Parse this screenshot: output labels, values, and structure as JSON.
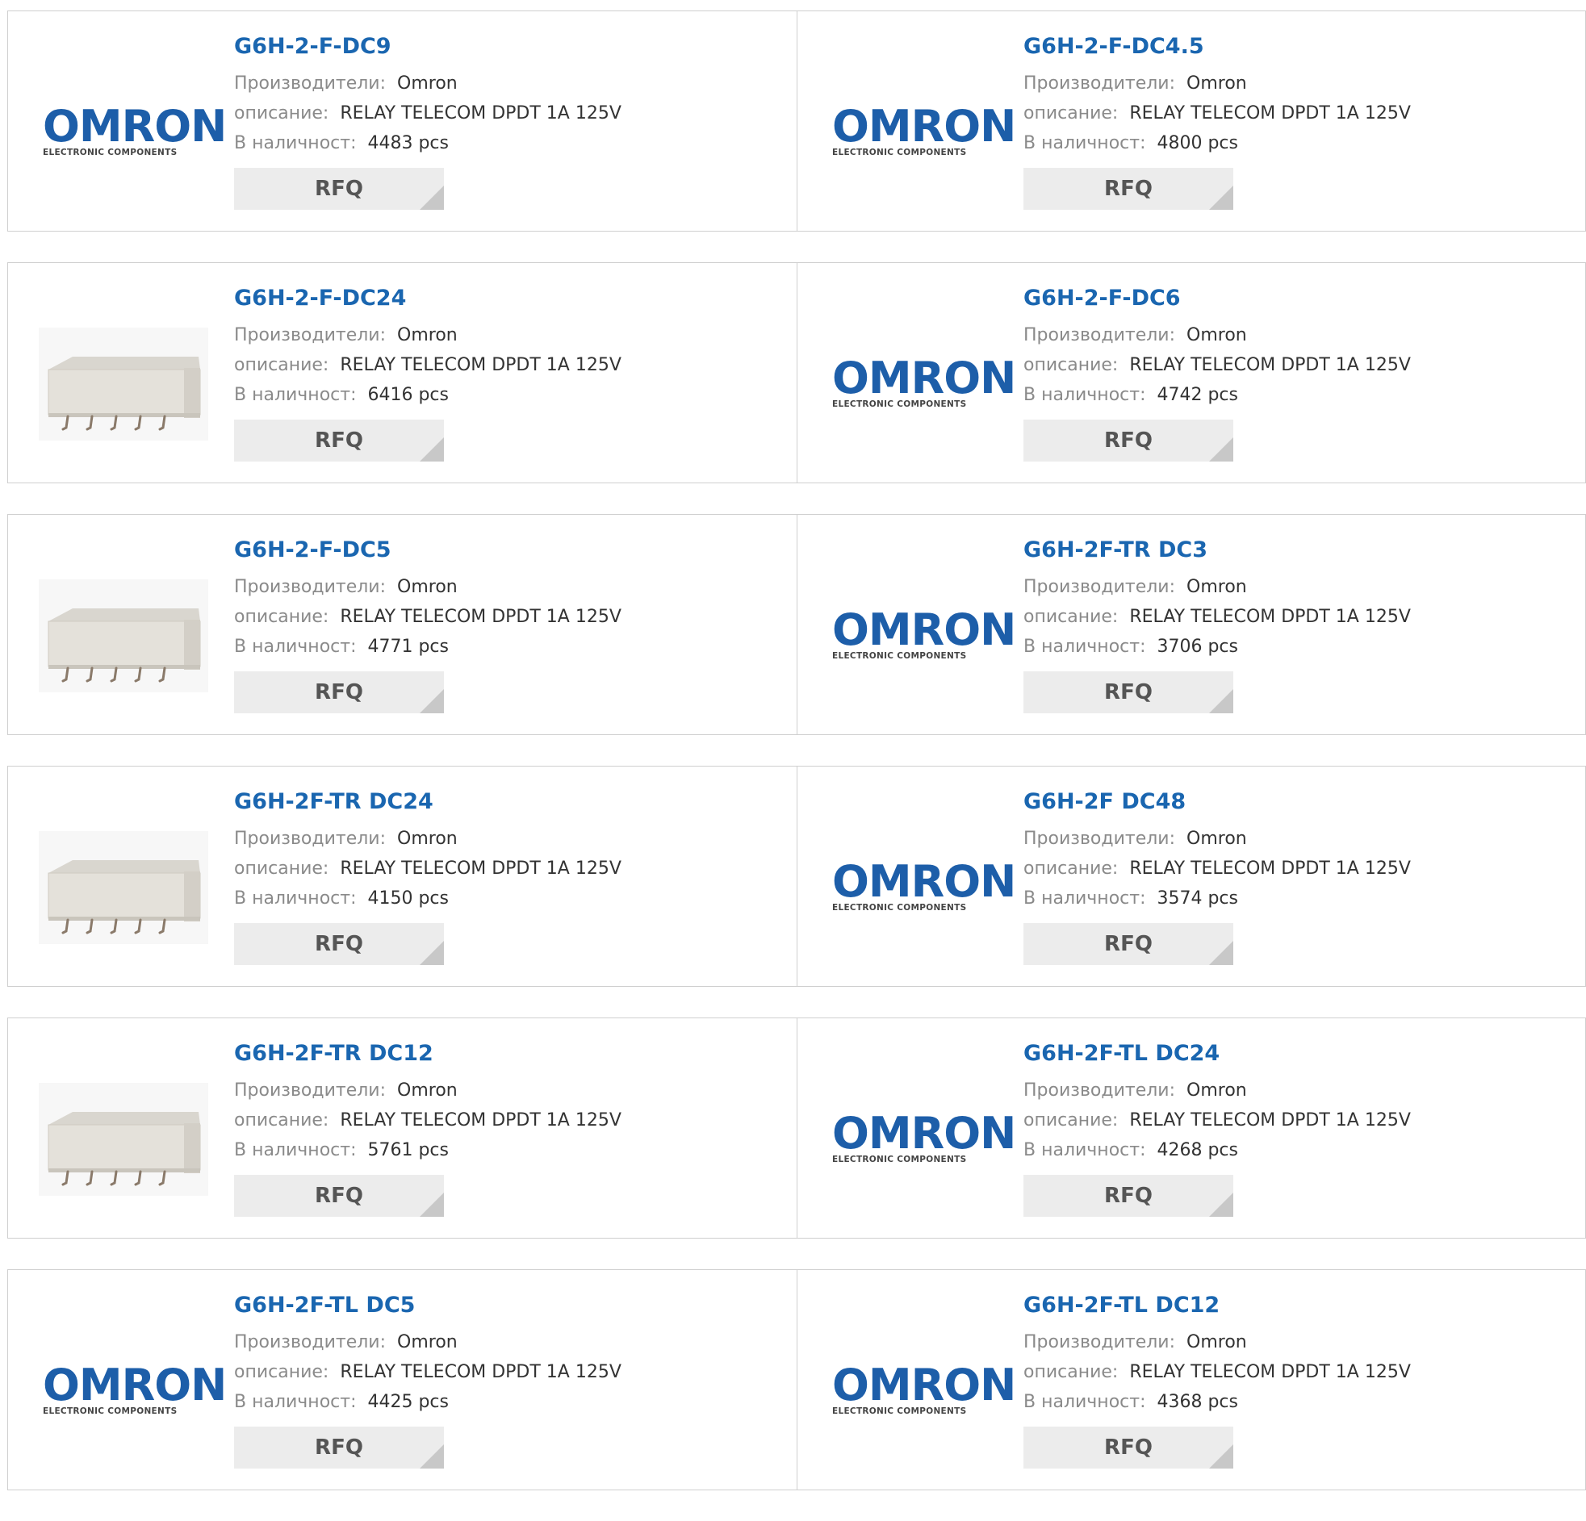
{
  "labels": {
    "manufacturer": "Производители:",
    "description": "описание:",
    "stock": "В наличност:",
    "rfq": "RFQ"
  },
  "logo": {
    "word": "OMRON",
    "sub": "ELECTRONIC COMPONENTS"
  },
  "colors": {
    "part_link": "#1a66b0",
    "logo_blue": "#1d5ea9",
    "rfq_bg": "#ececec"
  },
  "products": [
    {
      "part": "G6H-2-F-DC9",
      "manufacturer": "Omron",
      "description": "RELAY TELECOM DPDT 1A 125V",
      "stock": "4483 pcs",
      "image": "omron-logo"
    },
    {
      "part": "G6H-2-F-DC4.5",
      "manufacturer": "Omron",
      "description": "RELAY TELECOM DPDT 1A 125V",
      "stock": "4800 pcs",
      "image": "omron-logo"
    },
    {
      "part": "G6H-2-F-DC24",
      "manufacturer": "Omron",
      "description": "RELAY TELECOM DPDT 1A 125V",
      "stock": "6416 pcs",
      "image": "relay-photo"
    },
    {
      "part": "G6H-2-F-DC6",
      "manufacturer": "Omron",
      "description": "RELAY TELECOM DPDT 1A 125V",
      "stock": "4742 pcs",
      "image": "omron-logo"
    },
    {
      "part": "G6H-2-F-DC5",
      "manufacturer": "Omron",
      "description": "RELAY TELECOM DPDT 1A 125V",
      "stock": "4771 pcs",
      "image": "relay-photo"
    },
    {
      "part": "G6H-2F-TR DC3",
      "manufacturer": "Omron",
      "description": "RELAY TELECOM DPDT 1A 125V",
      "stock": "3706 pcs",
      "image": "omron-logo"
    },
    {
      "part": "G6H-2F-TR DC24",
      "manufacturer": "Omron",
      "description": "RELAY TELECOM DPDT 1A 125V",
      "stock": "4150 pcs",
      "image": "relay-photo"
    },
    {
      "part": "G6H-2F DC48",
      "manufacturer": "Omron",
      "description": "RELAY TELECOM DPDT 1A 125V",
      "stock": "3574 pcs",
      "image": "omron-logo"
    },
    {
      "part": "G6H-2F-TR DC12",
      "manufacturer": "Omron",
      "description": "RELAY TELECOM DPDT 1A 125V",
      "stock": "5761 pcs",
      "image": "relay-photo"
    },
    {
      "part": "G6H-2F-TL DC24",
      "manufacturer": "Omron",
      "description": "RELAY TELECOM DPDT 1A 125V",
      "stock": "4268 pcs",
      "image": "omron-logo"
    },
    {
      "part": "G6H-2F-TL DC5",
      "manufacturer": "Omron",
      "description": "RELAY TELECOM DPDT 1A 125V",
      "stock": "4425 pcs",
      "image": "omron-logo"
    },
    {
      "part": "G6H-2F-TL DC12",
      "manufacturer": "Omron",
      "description": "RELAY TELECOM DPDT 1A 125V",
      "stock": "4368 pcs",
      "image": "omron-logo"
    }
  ]
}
